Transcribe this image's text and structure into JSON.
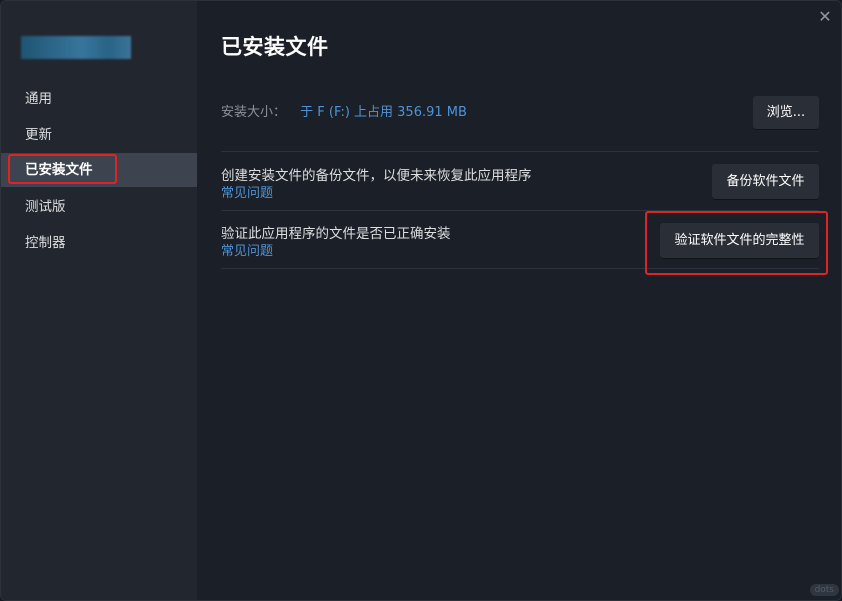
{
  "sidebar": {
    "items": [
      {
        "label": "通用"
      },
      {
        "label": "更新"
      },
      {
        "label": "已安装文件"
      },
      {
        "label": "测试版"
      },
      {
        "label": "控制器"
      }
    ]
  },
  "window": {
    "close_label": "✕"
  },
  "main": {
    "title": "已安装文件",
    "install_size": {
      "label": "安装大小：",
      "value": "于 F (F:) 上占用 356.91 MB"
    },
    "browse_label": "浏览...",
    "backup": {
      "description": "创建安装文件的备份文件，以便未来恢复此应用程序",
      "faq_label": "常见问题",
      "button_label": "备份软件文件"
    },
    "verify": {
      "description": "验证此应用程序的文件是否已正确安装",
      "faq_label": "常见问题",
      "button_label": "验证软件文件的完整性"
    }
  },
  "watermark": "dots",
  "colors": {
    "accent_link": "#4f93d6",
    "highlight": "#e02424",
    "sidebar_bg": "#22262e",
    "main_bg": "#1b2028"
  }
}
